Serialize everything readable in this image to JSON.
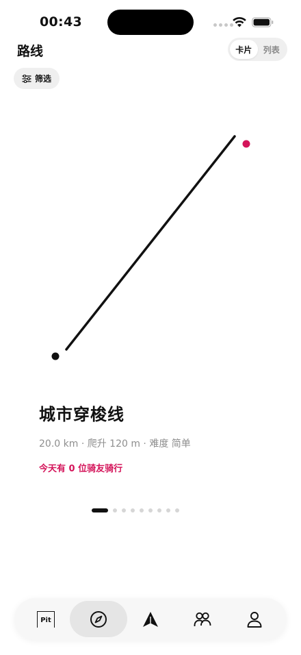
{
  "status_bar": {
    "time": "00:43"
  },
  "header": {
    "title": "路线",
    "view_toggle": {
      "options": [
        "卡片",
        "列表"
      ],
      "selected": "卡片"
    }
  },
  "filter": {
    "label": "筛选"
  },
  "route": {
    "name": "城市穿梭线",
    "meta": "20.0 km · 爬升 120 m · 难度 简单",
    "riders_today": "今天有 0 位骑友骑行",
    "accent_color": "#d4145a"
  },
  "pager": {
    "total": 9,
    "current": 1
  },
  "tab_bar": {
    "tabs": [
      {
        "name": "pit",
        "label": "Pit",
        "icon": "pit-icon"
      },
      {
        "name": "explore",
        "icon": "compass-icon",
        "active": true
      },
      {
        "name": "ride",
        "icon": "navigation-arrow-icon"
      },
      {
        "name": "community",
        "icon": "people-icon"
      },
      {
        "name": "profile",
        "icon": "person-icon"
      }
    ]
  }
}
